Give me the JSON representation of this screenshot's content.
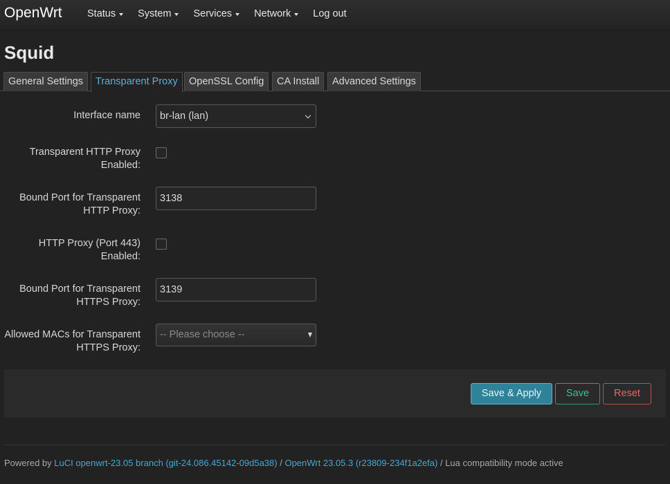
{
  "navbar": {
    "brand": "OpenWrt",
    "menu": [
      {
        "label": "Status",
        "has_dropdown": true
      },
      {
        "label": "System",
        "has_dropdown": true
      },
      {
        "label": "Services",
        "has_dropdown": true
      },
      {
        "label": "Network",
        "has_dropdown": true
      },
      {
        "label": "Log out",
        "has_dropdown": false
      }
    ]
  },
  "page": {
    "title": "Squid"
  },
  "tabs": [
    {
      "label": "General Settings",
      "active": false
    },
    {
      "label": "Transparent Proxy",
      "active": true
    },
    {
      "label": "OpenSSL Config",
      "active": false
    },
    {
      "label": "CA Install",
      "active": false
    },
    {
      "label": "Advanced Settings",
      "active": false
    }
  ],
  "form": {
    "interface_name": {
      "label": "Interface name",
      "value": "br-lan (lan)"
    },
    "transparent_http": {
      "label_line1": "Transparent HTTP Proxy",
      "label_line2": "Enabled:",
      "checked": false
    },
    "http_port": {
      "label_line1": "Bound Port for Transparent",
      "label_line2": "HTTP Proxy:",
      "value": "3138"
    },
    "https_enabled": {
      "label_line1": "HTTP Proxy (Port 443)",
      "label_line2": "Enabled:",
      "checked": false
    },
    "https_port": {
      "label_line1": "Bound Port for Transparent",
      "label_line2": "HTTPS Proxy:",
      "value": "3139"
    },
    "allowed_macs": {
      "label_line1": "Allowed MACs for Transparent",
      "label_line2": "HTTPS Proxy:",
      "placeholder": "-- Please choose --"
    }
  },
  "actions": {
    "save_apply": "Save & Apply",
    "save": "Save",
    "reset": "Reset"
  },
  "footer": {
    "prefix": "Powered by ",
    "luci_link": "LuCI openwrt-23.05 branch (git-24.086.45142-09d5a38)",
    "sep1": " / ",
    "openwrt_link": "OpenWrt 23.05.3 (r23809-234f1a2efa)",
    "sep2": " / ",
    "suffix": "Lua compatibility mode active"
  },
  "colors": {
    "background": "#222222",
    "accent": "#5ab0d8",
    "apply": "#2e8299",
    "save": "#2aa17a",
    "reset": "#c0504d"
  }
}
